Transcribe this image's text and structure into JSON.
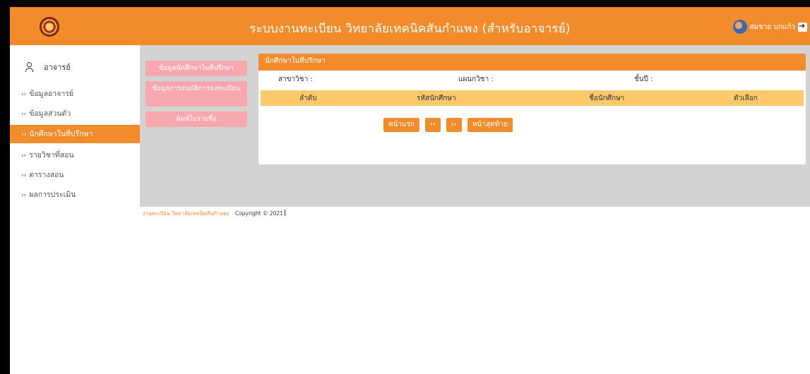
{
  "header": {
    "title": "ระบบงานทะเบียน วิทยาลัยเทคนิคสันกำแพง (สำหรับอาจารย์)",
    "user_name": "สมชาย บกแก้ว",
    "logo_icon": "college-seal-icon",
    "logout_icon": "logout-icon",
    "accent": "#f28b2a"
  },
  "sidebar": {
    "role": "อาจารย์",
    "items": [
      {
        "label": "ข้อมูลอาจารย์"
      },
      {
        "label": "ข้อมูลส่วนตัว"
      },
      {
        "label": "นักศึกษาในที่ปรึกษา"
      },
      {
        "label": "รายวิชาที่สอน"
      },
      {
        "label": "ตารางสอน"
      },
      {
        "label": "ผลการประเมิน"
      }
    ],
    "chevron": "››"
  },
  "actions": {
    "student_info": "ข้อมูลนักศึกษาในที่ปรึกษา",
    "approve_registration": "ข้อมูลการอนุมัติการลงทะเบียน",
    "print_list": "พิมพ์ใบรายชื่อ"
  },
  "card": {
    "title": "นักศึกษาในที่ปรึกษา",
    "major_label": "สาขาวิชา :",
    "department_label": "แผนกวิชา :",
    "level_label": "ชั้นปี :",
    "columns": [
      "ลำดับ",
      "รหัสนักศึกษา",
      "ชื่อนักศึกษา",
      "ตัวเลือก"
    ],
    "pager": {
      "first": "หน้าแรก",
      "prev": "‹‹",
      "next": "››",
      "last": "หน้าสุดท้าย"
    }
  },
  "footer": {
    "link": "งานทะเบียน วิทยาลัยเทคนิคสันกำแพง",
    "copyright": "Copyright © 2021"
  }
}
